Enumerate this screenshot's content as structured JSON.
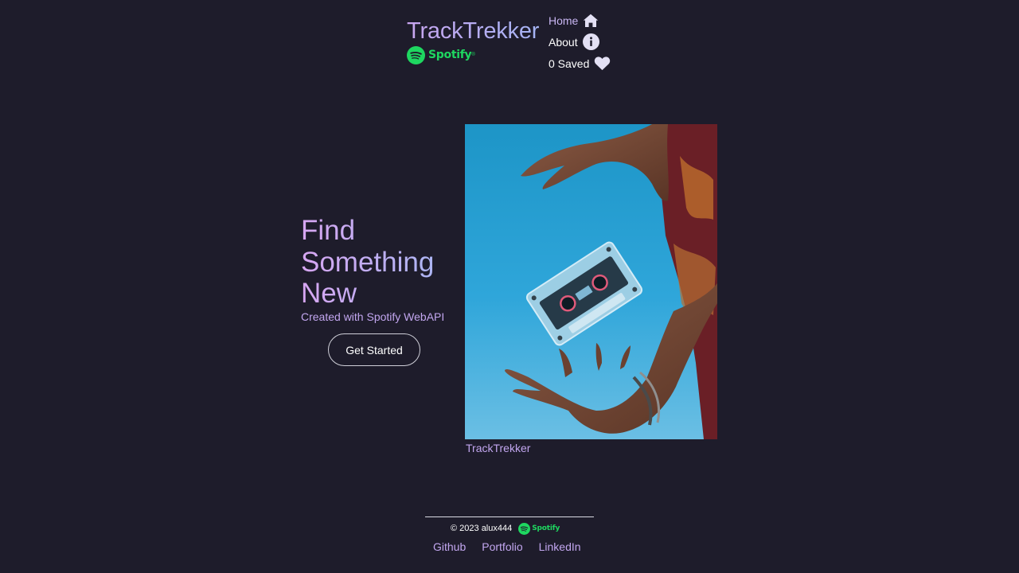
{
  "header": {
    "brand_title": "TrackTrekker",
    "spotify_label": "Spotify"
  },
  "nav": {
    "home": {
      "label": "Home",
      "icon": "home-icon"
    },
    "about": {
      "label": "About",
      "icon": "info-icon"
    },
    "saved": {
      "label": "0 Saved",
      "count": 0,
      "icon": "heart-icon"
    }
  },
  "hero": {
    "title_lines": [
      "Find",
      "Something",
      "New"
    ],
    "subtitle": "Created with Spotify WebAPI",
    "cta_label": "Get Started",
    "image_caption": "TrackTrekker"
  },
  "footer": {
    "copyright": "© 2023 alux444",
    "spotify_label": "Spotify",
    "links": [
      "Github",
      "Portfolio",
      "LinkedIn"
    ]
  },
  "colors": {
    "background": "#1e1c2b",
    "accent_purple": "#c2a6ef",
    "spotify_green": "#1ed760"
  }
}
